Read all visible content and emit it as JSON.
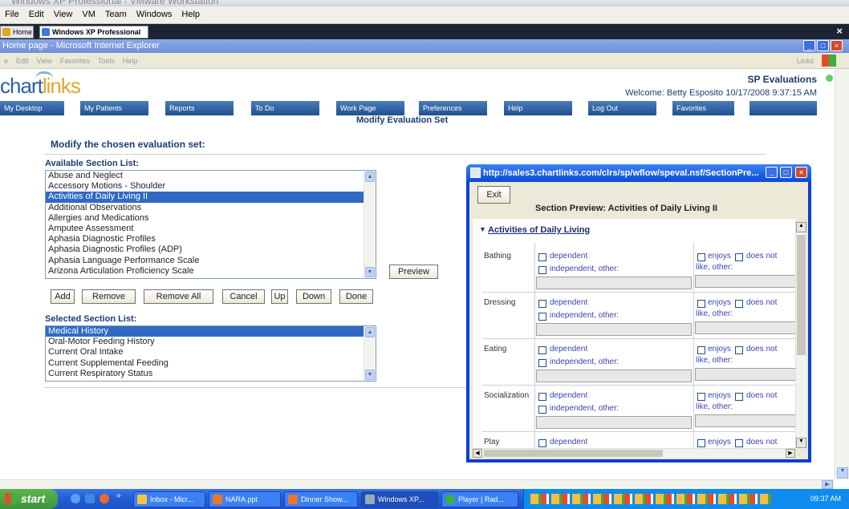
{
  "vmware": {
    "title": "Windows XP Professional - VMware Workstation",
    "menu": [
      "File",
      "Edit",
      "View",
      "VM",
      "Team",
      "Windows",
      "Help"
    ],
    "tabs": [
      "Home",
      "Windows XP Professional"
    ]
  },
  "ie": {
    "title": "Home page - Microsoft Internet Explorer",
    "menu": [
      "e",
      "Edit",
      "View",
      "Favorites",
      "Tools",
      "Help"
    ],
    "links": "Links"
  },
  "page": {
    "logo": {
      "chart": "chart",
      "links": "links"
    },
    "app_title": "SP Evaluations",
    "welcome": "Welcome: Betty Esposito   10/17/2008 9:37:15 AM",
    "nav": [
      "My Desktop",
      "My Patients",
      "Reports",
      "To Do",
      "Work Page",
      "Preferences",
      "Help",
      "Log Out",
      "Favorites",
      ""
    ],
    "heading": "Modify Evaluation Set",
    "modify_label": "Modify the chosen evaluation set:",
    "available_label": "Available Section List:",
    "available": [
      "Abuse and Neglect",
      "Accessory Motions - Shoulder",
      "Activities of Daily Living II",
      "Additional Observations",
      "Allergies and Medications",
      "Amputee Assessment",
      "Aphasia Diagnostic Profiles",
      "Aphasia Diagnostic Profiles (ADP)",
      "Aphasia Language Performance Scale",
      "Arizona Articulation Proficiency Scale"
    ],
    "available_selected": "Activities of Daily Living II",
    "preview": "Preview",
    "buttons": {
      "add": "Add",
      "remove": "Remove",
      "remove_all": "Remove All",
      "cancel": "Cancel",
      "up": "Up",
      "down": "Down",
      "done": "Done"
    },
    "selected_label": "Selected Section List:",
    "selected": [
      "Medical History",
      "Oral-Motor Feeding History",
      "Current Oral Intake",
      "Current Supplemental Feeding",
      "Current Respiratory Status"
    ]
  },
  "popup": {
    "title": "http://sales3.chartlinks.com/clrs/sp/wflow/speval.nsf/SectionPre...",
    "exit": "Exit",
    "heading": "Section Preview: Activities of Daily Living II",
    "section": "Activities of Daily Living",
    "rows": [
      {
        "label": "Bathing",
        "opt1": "dependent",
        "opt2": "independent, other:",
        "opt3": "enjoys",
        "opt4": "does not",
        "opt5": "like, other:"
      },
      {
        "label": "Dressing",
        "opt1": "dependent",
        "opt2": "independent, other:",
        "opt3": "enjoys",
        "opt4": "does not",
        "opt5": "like, other:"
      },
      {
        "label": "Eating",
        "opt1": "dependent",
        "opt2": "independent, other:",
        "opt3": "enjoys",
        "opt4": "does not",
        "opt5": "like, other:"
      },
      {
        "label": "Socialization",
        "opt1": "dependent",
        "opt2": "independent, other:",
        "opt3": "enjoys",
        "opt4": "does not",
        "opt5": "like, other:"
      },
      {
        "label": "Play",
        "opt1": "dependent",
        "opt2": "",
        "opt3": "enjoys",
        "opt4": "does not",
        "opt5": ""
      }
    ]
  },
  "taskbar": {
    "start": "start",
    "tasks": [
      "Inbox - Micr...",
      "NARA.ppt",
      "Dinner Show...",
      "Windows XP...",
      "Player | Rad..."
    ],
    "clock": "09:37 AM"
  }
}
